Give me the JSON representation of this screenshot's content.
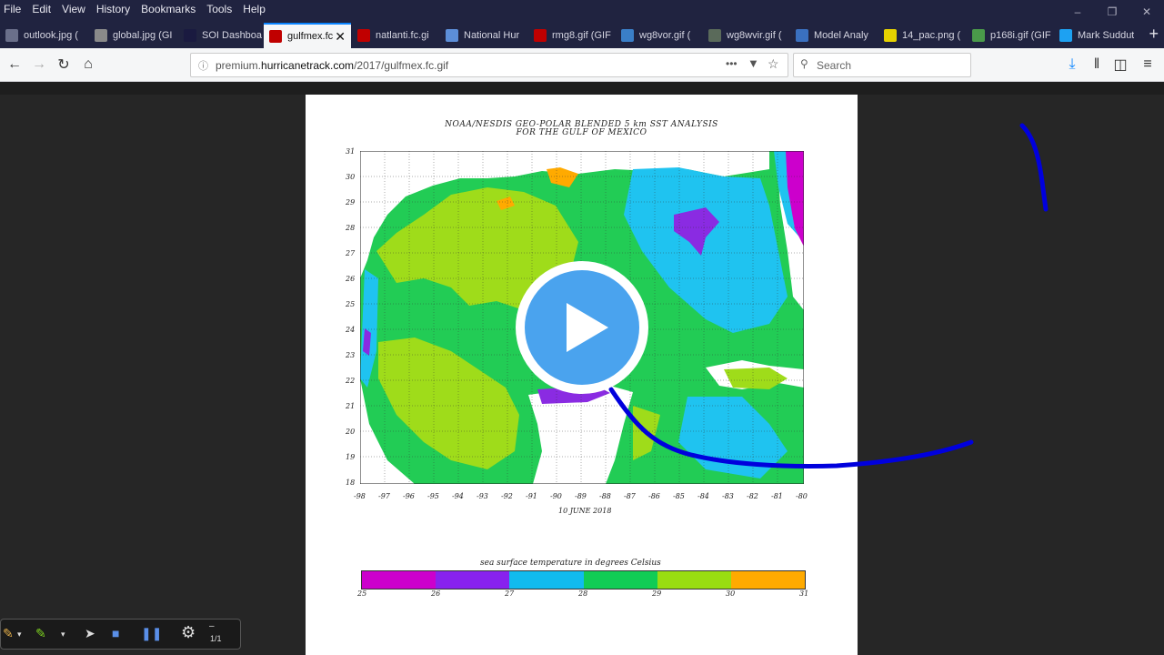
{
  "menu": [
    "File",
    "Edit",
    "View",
    "History",
    "Bookmarks",
    "Tools",
    "Help"
  ],
  "tabs": [
    {
      "label": "outlook.jpg (",
      "color": "#6a6f8a"
    },
    {
      "label": "global.jpg (GI",
      "color": "#8a8a8a"
    },
    {
      "label": "SOI Dashboa",
      "color": "#1a1a40"
    },
    {
      "label": "gulfmex.fc",
      "color": "#c00000",
      "active": true
    },
    {
      "label": "natlanti.fc.gi",
      "color": "#c00000"
    },
    {
      "label": "National Hur",
      "color": "#5c8ed8"
    },
    {
      "label": "rmg8.gif (GIF",
      "color": "#c00000"
    },
    {
      "label": "wg8vor.gif (",
      "color": "#3a7fc8"
    },
    {
      "label": "wg8wvir.gif (",
      "color": "#5a6a5a"
    },
    {
      "label": "Model Analy",
      "color": "#3a70c0"
    },
    {
      "label": "14_pac.png (",
      "color": "#e6d200"
    },
    {
      "label": "p168i.gif (GIF",
      "color": "#4a9a4a"
    },
    {
      "label": "Mark Suddut",
      "color": "#1da1f2"
    }
  ],
  "url": {
    "prefix": "premium.",
    "domain": "hurricanetrack.com",
    "path": "/2017/gulfmex.fc.gif"
  },
  "search_placeholder": "Search",
  "map": {
    "title_line1": "NOAA/NESDIS GEO-POLAR BLENDED 5 km SST ANALYSIS",
    "title_line2": "FOR THE GULF OF MEXICO",
    "lat_labels": [
      "31",
      "30",
      "29",
      "28",
      "27",
      "26",
      "25",
      "24",
      "23",
      "22",
      "21",
      "20",
      "19",
      "18"
    ],
    "lon_labels": [
      "-98",
      "-97",
      "-96",
      "-95",
      "-94",
      "-93",
      "-92",
      "-91",
      "-90",
      "-89",
      "-88",
      "-87",
      "-86",
      "-85",
      "-84",
      "-83",
      "-82",
      "-81",
      "-80"
    ],
    "date": "10 JUNE 2018",
    "colorbar_title": "sea surface temperature in degrees Celsius",
    "colorbar_colors": [
      "#cc00cc",
      "#8822ee",
      "#11bbee",
      "#11cc55",
      "#99dd11",
      "#ffaa00"
    ],
    "colorbar_labels": [
      "25",
      "26",
      "27",
      "28",
      "29",
      "30",
      "31"
    ],
    "colors": {
      "green": "#22cc55",
      "lime": "#9fdc1a",
      "cyan": "#1fc3f0",
      "purple": "#8a2be2",
      "magenta": "#cc00cc",
      "orange": "#ffaa00",
      "land": "#ffffff"
    }
  },
  "drawbar": {
    "page_count": "1/1"
  }
}
